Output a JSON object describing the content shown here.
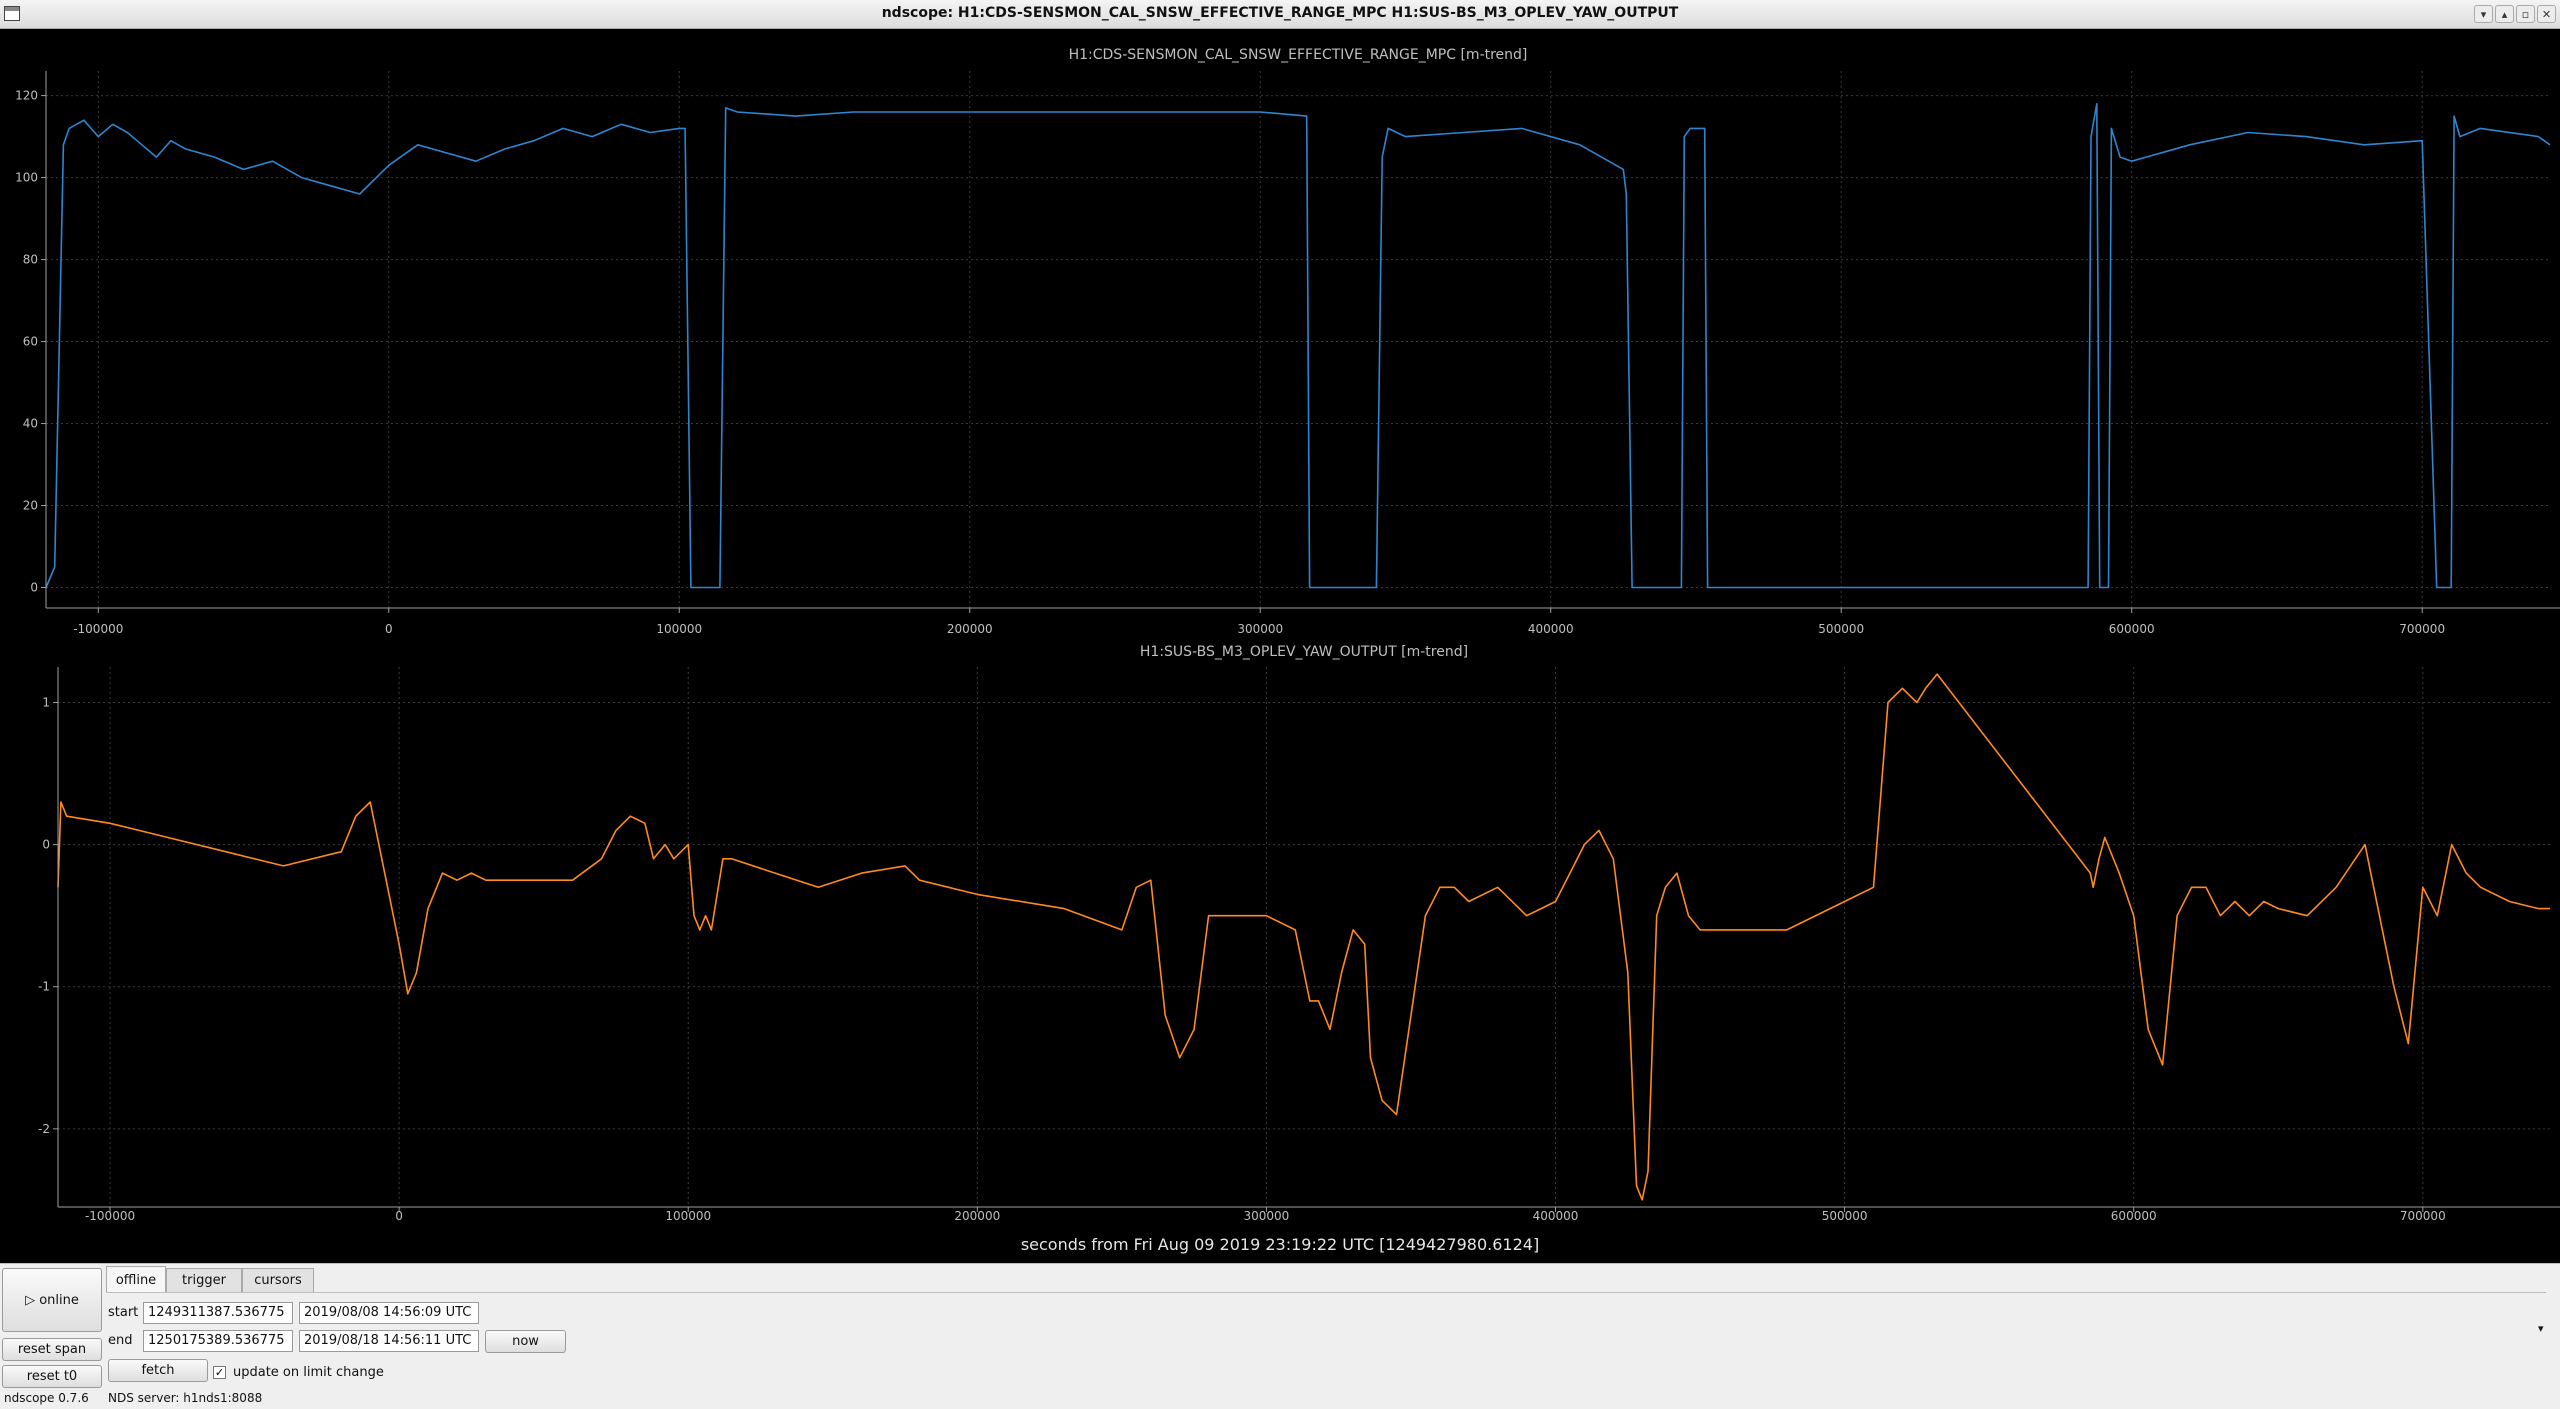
{
  "window": {
    "title": "ndscope: H1:CDS-SENSMON_CAL_SNSW_EFFECTIVE_RANGE_MPC H1:SUS-BS_M3_OPLEV_YAW_OUTPUT",
    "controls": [
      "▾",
      "▴",
      "▫",
      "✕"
    ]
  },
  "theme": {
    "background": "#000000",
    "axis_color": "#a0a0a0",
    "grid_color": "#3a3a3a"
  },
  "chart_data": [
    {
      "type": "line",
      "title": "H1:CDS-SENSMON_CAL_SNSW_EFFECTIVE_RANGE_MPC [m-trend]",
      "xlabel": "",
      "ylabel": "",
      "xlim": [
        -118000,
        744000
      ],
      "ylim": [
        -5,
        126
      ],
      "xticks": [
        -100000,
        0,
        100000,
        200000,
        300000,
        400000,
        500000,
        600000,
        700000
      ],
      "xtick_labels": [
        "-100000",
        "0",
        "100000",
        "200000",
        "300000",
        "400000",
        "500000",
        "600000",
        "700000"
      ],
      "yticks": [
        0,
        20,
        40,
        60,
        80,
        100,
        120
      ],
      "ytick_labels": [
        "0",
        "20",
        "40",
        "60",
        "80",
        "100",
        "120"
      ],
      "grid": true,
      "series": [
        {
          "color": "#2e86d1",
          "x": [
            -118000,
            -115000,
            -112000,
            -110000,
            -105000,
            -100000,
            -95000,
            -90000,
            -85000,
            -80000,
            -75000,
            -70000,
            -60000,
            -50000,
            -40000,
            -30000,
            -20000,
            -10000,
            0,
            10000,
            20000,
            30000,
            40000,
            50000,
            60000,
            70000,
            80000,
            90000,
            100000,
            102000,
            104000,
            110000,
            114000,
            116000,
            120000,
            140000,
            160000,
            180000,
            200000,
            220000,
            240000,
            260000,
            280000,
            300000,
            316000,
            317000,
            320000,
            330000,
            340000,
            342000,
            344000,
            350000,
            370000,
            390000,
            410000,
            425000,
            426000,
            428000,
            440000,
            445000,
            446000,
            448000,
            453000,
            454000,
            456000,
            470000,
            500000,
            530000,
            560000,
            585000,
            586000,
            588000,
            589000,
            592000,
            593000,
            596000,
            600000,
            620000,
            640000,
            660000,
            680000,
            700000,
            705000,
            706000,
            708000,
            710000,
            711000,
            713000,
            720000,
            740000,
            744000
          ],
          "y": [
            0,
            5,
            108,
            112,
            114,
            110,
            113,
            111,
            108,
            105,
            109,
            107,
            105,
            102,
            104,
            100,
            98,
            96,
            103,
            108,
            106,
            104,
            107,
            109,
            112,
            110,
            113,
            111,
            112,
            112,
            0,
            0,
            0,
            117,
            116,
            115,
            116,
            116,
            116,
            116,
            116,
            116,
            116,
            116,
            115,
            0,
            0,
            0,
            0,
            105,
            112,
            110,
            111,
            112,
            108,
            102,
            96,
            0,
            0,
            0,
            110,
            112,
            112,
            0,
            0,
            0,
            0,
            0,
            0,
            0,
            110,
            118,
            0,
            0,
            112,
            105,
            104,
            108,
            111,
            110,
            108,
            109,
            0,
            0,
            0,
            0,
            115,
            110,
            112,
            110,
            108
          ]
        }
      ]
    },
    {
      "type": "line",
      "title": "H1:SUS-BS_M3_OPLEV_YAW_OUTPUT [m-trend]",
      "xlabel": "seconds from Fri Aug 09 2019 23:19:22 UTC [1249427980.6124]",
      "ylabel": "",
      "xlim": [
        -118000,
        744000
      ],
      "ylim": [
        -2.55,
        1.25
      ],
      "xticks": [
        -100000,
        0,
        100000,
        200000,
        300000,
        400000,
        500000,
        600000,
        700000
      ],
      "xtick_labels": [
        "-100000",
        "0",
        "100000",
        "200000",
        "300000",
        "400000",
        "500000",
        "600000",
        "700000"
      ],
      "yticks": [
        -2,
        -1,
        0,
        1
      ],
      "ytick_labels": [
        "-2",
        "-1",
        "0",
        "1"
      ],
      "grid": true,
      "series": [
        {
          "color": "#ff8a1f",
          "x": [
            -118000,
            -117000,
            -115000,
            -100000,
            -80000,
            -60000,
            -40000,
            -20000,
            -15000,
            -10000,
            -5000,
            0,
            3000,
            6000,
            10000,
            15000,
            20000,
            25000,
            30000,
            40000,
            50000,
            60000,
            70000,
            75000,
            80000,
            85000,
            88000,
            92000,
            95000,
            100000,
            102000,
            104000,
            106000,
            108000,
            112000,
            115000,
            130000,
            145000,
            160000,
            175000,
            180000,
            200000,
            230000,
            250000,
            255000,
            260000,
            265000,
            270000,
            275000,
            280000,
            285000,
            290000,
            300000,
            310000,
            315000,
            318000,
            322000,
            326000,
            330000,
            334000,
            336000,
            340000,
            345000,
            350000,
            355000,
            360000,
            365000,
            370000,
            380000,
            390000,
            395000,
            400000,
            405000,
            410000,
            415000,
            420000,
            425000,
            428000,
            430000,
            432000,
            435000,
            438000,
            442000,
            446000,
            450000,
            460000,
            480000,
            500000,
            510000,
            515000,
            520000,
            525000,
            528000,
            532000,
            585000,
            586000,
            588000,
            590000,
            595000,
            600000,
            605000,
            610000,
            615000,
            620000,
            625000,
            630000,
            635000,
            640000,
            645000,
            650000,
            660000,
            670000,
            680000,
            690000,
            695000,
            700000,
            705000,
            710000,
            715000,
            720000,
            730000,
            740000,
            744000
          ],
          "y": [
            -0.3,
            0.3,
            0.2,
            0.15,
            0.05,
            -0.05,
            -0.15,
            -0.05,
            0.2,
            0.3,
            -0.2,
            -0.7,
            -1.05,
            -0.9,
            -0.45,
            -0.2,
            -0.25,
            -0.2,
            -0.25,
            -0.25,
            -0.25,
            -0.25,
            -0.1,
            0.1,
            0.2,
            0.15,
            -0.1,
            0.0,
            -0.1,
            0.0,
            -0.5,
            -0.6,
            -0.5,
            -0.6,
            -0.1,
            -0.1,
            -0.2,
            -0.3,
            -0.2,
            -0.15,
            -0.25,
            -0.35,
            -0.45,
            -0.6,
            -0.3,
            -0.25,
            -1.2,
            -1.5,
            -1.3,
            -0.5,
            -0.5,
            -0.5,
            -0.5,
            -0.6,
            -1.1,
            -1.1,
            -1.3,
            -0.9,
            -0.6,
            -0.7,
            -1.5,
            -1.8,
            -1.9,
            -1.2,
            -0.5,
            -0.3,
            -0.3,
            -0.4,
            -0.3,
            -0.5,
            -0.45,
            -0.4,
            -0.2,
            0.0,
            0.1,
            -0.1,
            -0.9,
            -2.4,
            -2.5,
            -2.3,
            -0.5,
            -0.3,
            -0.2,
            -0.5,
            -0.6,
            -0.6,
            -0.6,
            -0.4,
            -0.3,
            1.0,
            1.1,
            1.0,
            1.1,
            1.2,
            -0.2,
            -0.3,
            -0.1,
            0.05,
            -0.2,
            -0.5,
            -1.3,
            -1.55,
            -0.5,
            -0.3,
            -0.3,
            -0.5,
            -0.4,
            -0.5,
            -0.4,
            -0.45,
            -0.5,
            -0.3,
            0.0,
            -1.0,
            -1.4,
            -0.3,
            -0.5,
            0.0,
            -0.2,
            -0.3,
            -0.4,
            -0.45,
            -0.45
          ]
        }
      ]
    }
  ],
  "panel": {
    "online_label": "▷ online",
    "reset_span_label": "reset span",
    "reset_t0_label": "reset t0",
    "fetch_label": "fetch",
    "now_label": "now",
    "tabs": [
      {
        "label": "offline"
      },
      {
        "label": "trigger"
      },
      {
        "label": "cursors"
      }
    ],
    "start_label": "start",
    "start_gps": "1249311387.536775",
    "start_utc": "2019/08/08 14:56:09 UTC",
    "end_label": "end",
    "end_gps": "1250175389.536775",
    "end_utc": "2019/08/18 14:56:11 UTC",
    "checkbox_mark": "✓",
    "update_label": "update on limit change",
    "version": "ndscope 0.7.6",
    "nds_server": "NDS server: h1nds1:8088",
    "scroll_arrow": "▾"
  }
}
